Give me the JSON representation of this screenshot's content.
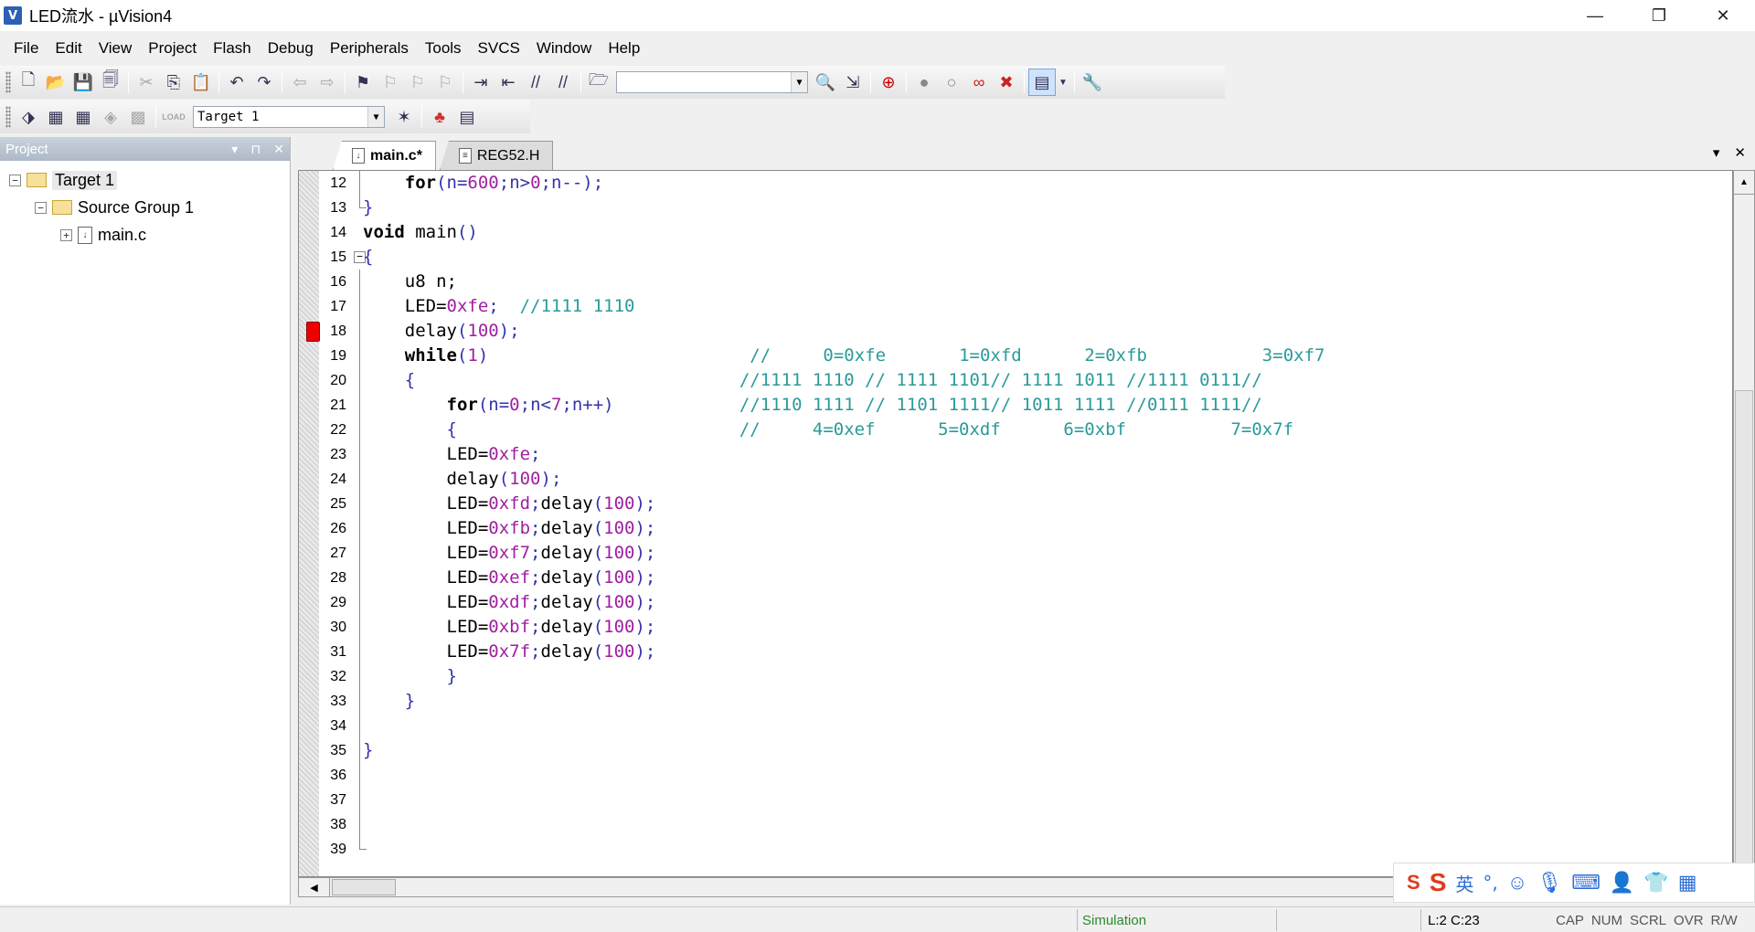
{
  "window": {
    "title": "LED流水  - µVision4",
    "icon_letter": "V",
    "controls": [
      "—",
      "❐",
      "✕"
    ]
  },
  "menu": [
    {
      "label": "File"
    },
    {
      "label": "Edit"
    },
    {
      "label": "View"
    },
    {
      "label": "Project"
    },
    {
      "label": "Flash"
    },
    {
      "label": "Debug"
    },
    {
      "label": "Peripherals"
    },
    {
      "label": "Tools"
    },
    {
      "label": "SVCS"
    },
    {
      "label": "Window"
    },
    {
      "label": "Help"
    }
  ],
  "toolbar2": {
    "load_label": "LOAD",
    "target_combo": "Target 1"
  },
  "project_panel": {
    "title": "Project",
    "controls": [
      "▾",
      "⊓",
      "✕"
    ],
    "tree": {
      "target": "Target 1",
      "group": "Source Group 1",
      "file": "main.c"
    }
  },
  "tabs": [
    {
      "label": "main.c*",
      "active": true
    },
    {
      "label": "REG52.H",
      "active": false
    }
  ],
  "tab_controls": [
    "▾",
    "✕"
  ],
  "code_lines": [
    {
      "n": "12",
      "fold": "line",
      "tokens": [
        [
          "",
          "    "
        ],
        [
          "kw",
          "for"
        ],
        [
          "pu",
          "(n="
        ],
        [
          "num",
          "600"
        ],
        [
          "pu",
          ";n>"
        ],
        [
          "num",
          "0"
        ],
        [
          "pu",
          ";n--);"
        ]
      ]
    },
    {
      "n": "13",
      "fold": "end",
      "tokens": [
        [
          "pu",
          "}"
        ]
      ]
    },
    {
      "n": "14",
      "fold": "",
      "tokens": [
        [
          "kw",
          "void"
        ],
        [
          "",
          " main"
        ],
        [
          "pu",
          "()"
        ]
      ]
    },
    {
      "n": "15",
      "fold": "box",
      "tokens": [
        [
          "pu",
          "{"
        ]
      ]
    },
    {
      "n": "16",
      "fold": "line",
      "tokens": [
        [
          "",
          "    u8 n;"
        ]
      ]
    },
    {
      "n": "17",
      "fold": "line",
      "tokens": [
        [
          "",
          "    LED="
        ],
        [
          "num",
          "0xfe"
        ],
        [
          "pu",
          ";"
        ],
        [
          "cm",
          "  //1111 1110"
        ]
      ]
    },
    {
      "n": "18",
      "fold": "line",
      "bp": true,
      "tokens": [
        [
          "",
          "    delay"
        ],
        [
          "pu",
          "("
        ],
        [
          "num",
          "100"
        ],
        [
          "pu",
          ");"
        ]
      ]
    },
    {
      "n": "19",
      "fold": "line",
      "tokens": [
        [
          "",
          "    "
        ],
        [
          "kw",
          "while"
        ],
        [
          "pu",
          "("
        ],
        [
          "num",
          "1"
        ],
        [
          "pu",
          ")"
        ],
        [
          "cm",
          "                         //     0=0xfe       1=0xfd      2=0xfb           3=0xf7"
        ]
      ]
    },
    {
      "n": "20",
      "fold": "line",
      "tokens": [
        [
          "",
          "    "
        ],
        [
          "pu",
          "{"
        ],
        [
          "cm",
          "                               //1111 1110 // 1111 1101// 1111 1011 //1111 0111//"
        ]
      ]
    },
    {
      "n": "21",
      "fold": "line",
      "tokens": [
        [
          "",
          "        "
        ],
        [
          "kw",
          "for"
        ],
        [
          "pu",
          "(n="
        ],
        [
          "num",
          "0"
        ],
        [
          "pu",
          ";n<"
        ],
        [
          "num",
          "7"
        ],
        [
          "pu",
          ";n++)"
        ],
        [
          "cm",
          "            //1110 1111 // 1101 1111// 1011 1111 //0111 1111//"
        ]
      ]
    },
    {
      "n": "22",
      "fold": "line",
      "tokens": [
        [
          "",
          "        "
        ],
        [
          "pu",
          "{"
        ],
        [
          "cm",
          "                           //     4=0xef      5=0xdf      6=0xbf          7=0x7f"
        ]
      ]
    },
    {
      "n": "23",
      "fold": "line",
      "tokens": [
        [
          "",
          "        LED="
        ],
        [
          "num",
          "0xfe"
        ],
        [
          "pu",
          ";"
        ]
      ]
    },
    {
      "n": "24",
      "fold": "line",
      "tokens": [
        [
          "",
          "        delay"
        ],
        [
          "pu",
          "("
        ],
        [
          "num",
          "100"
        ],
        [
          "pu",
          ");"
        ]
      ]
    },
    {
      "n": "25",
      "fold": "line",
      "tokens": [
        [
          "",
          "        LED="
        ],
        [
          "num",
          "0xfd"
        ],
        [
          "pu",
          ";"
        ],
        [
          "",
          "delay"
        ],
        [
          "pu",
          "("
        ],
        [
          "num",
          "100"
        ],
        [
          "pu",
          ");"
        ]
      ]
    },
    {
      "n": "26",
      "fold": "line",
      "tokens": [
        [
          "",
          "        LED="
        ],
        [
          "num",
          "0xfb"
        ],
        [
          "pu",
          ";"
        ],
        [
          "",
          "delay"
        ],
        [
          "pu",
          "("
        ],
        [
          "num",
          "100"
        ],
        [
          "pu",
          ");"
        ]
      ]
    },
    {
      "n": "27",
      "fold": "line",
      "tokens": [
        [
          "",
          "        LED="
        ],
        [
          "num",
          "0xf7"
        ],
        [
          "pu",
          ";"
        ],
        [
          "",
          "delay"
        ],
        [
          "pu",
          "("
        ],
        [
          "num",
          "100"
        ],
        [
          "pu",
          ");"
        ]
      ]
    },
    {
      "n": "28",
      "fold": "line",
      "tokens": [
        [
          "",
          "        LED="
        ],
        [
          "num",
          "0xef"
        ],
        [
          "pu",
          ";"
        ],
        [
          "",
          "delay"
        ],
        [
          "pu",
          "("
        ],
        [
          "num",
          "100"
        ],
        [
          "pu",
          ");"
        ]
      ]
    },
    {
      "n": "29",
      "fold": "line",
      "tokens": [
        [
          "",
          "        LED="
        ],
        [
          "num",
          "0xdf"
        ],
        [
          "pu",
          ";"
        ],
        [
          "",
          "delay"
        ],
        [
          "pu",
          "("
        ],
        [
          "num",
          "100"
        ],
        [
          "pu",
          ");"
        ]
      ]
    },
    {
      "n": "30",
      "fold": "line",
      "tokens": [
        [
          "",
          "        LED="
        ],
        [
          "num",
          "0xbf"
        ],
        [
          "pu",
          ";"
        ],
        [
          "",
          "delay"
        ],
        [
          "pu",
          "("
        ],
        [
          "num",
          "100"
        ],
        [
          "pu",
          ");"
        ]
      ]
    },
    {
      "n": "31",
      "fold": "line",
      "tokens": [
        [
          "",
          "        LED="
        ],
        [
          "num",
          "0x7f"
        ],
        [
          "pu",
          ";"
        ],
        [
          "",
          "delay"
        ],
        [
          "pu",
          "("
        ],
        [
          "num",
          "100"
        ],
        [
          "pu",
          ");"
        ]
      ]
    },
    {
      "n": "32",
      "fold": "line",
      "tokens": [
        [
          "",
          "        "
        ],
        [
          "pu",
          "}"
        ]
      ]
    },
    {
      "n": "33",
      "fold": "line",
      "tokens": [
        [
          "",
          "    "
        ],
        [
          "pu",
          "}"
        ]
      ]
    },
    {
      "n": "34",
      "fold": "line",
      "tokens": []
    },
    {
      "n": "35",
      "fold": "line",
      "tokens": [
        [
          "pu",
          "}"
        ]
      ]
    },
    {
      "n": "36",
      "fold": "line",
      "tokens": []
    },
    {
      "n": "37",
      "fold": "line",
      "tokens": []
    },
    {
      "n": "38",
      "fold": "line",
      "tokens": []
    },
    {
      "n": "39",
      "fold": "end",
      "tokens": []
    }
  ],
  "ime": {
    "lang_label": "英",
    "punct_label": "°,"
  },
  "status": {
    "mode": "Simulation",
    "position": "L:2 C:23",
    "flags": [
      "CAP",
      "NUM",
      "SCRL",
      "OVR",
      "R/W"
    ]
  }
}
